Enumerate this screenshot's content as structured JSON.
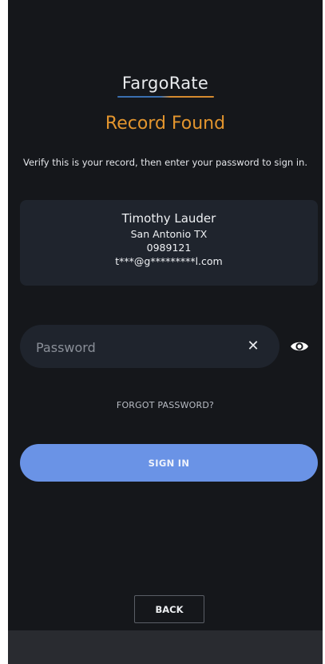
{
  "brand": {
    "logo_text": "FargoRate"
  },
  "header": {
    "title": "Record Found",
    "instructions": "Verify this is your record, then enter your password to sign in."
  },
  "record": {
    "name": "Timothy Lauder",
    "location": "San Antonio TX",
    "id": "0989121",
    "email": "t***@g*********l.com"
  },
  "password": {
    "placeholder": "Password",
    "value": "",
    "clear_icon": "close-icon",
    "visibility_icon": "eye-icon"
  },
  "links": {
    "forgot_password": "FORGOT PASSWORD?"
  },
  "buttons": {
    "sign_in": "SIGN IN",
    "back": "BACK"
  },
  "colors": {
    "background": "#15171b",
    "card": "#1f242d",
    "accent_orange": "#e3952e",
    "primary_blue": "#6a93e6"
  }
}
